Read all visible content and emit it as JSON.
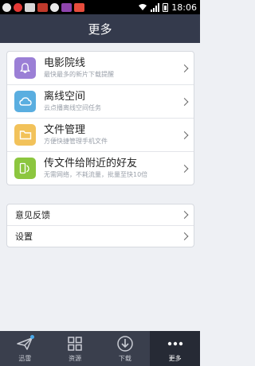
{
  "status_bar": {
    "time": "18:06",
    "notification_icons": [
      "qq-icon",
      "weibo-icon",
      "mail-icon",
      "image-icon",
      "qq-icon",
      "app-icon",
      "taobao-icon"
    ]
  },
  "header": {
    "title": "更多"
  },
  "menu_group": {
    "items": [
      {
        "icon": "bell-icon",
        "color": "#9b7fd6",
        "title": "电影院线",
        "subtitle": "最快最多的新片下载提醒"
      },
      {
        "icon": "cloud-icon",
        "color": "#5aaee0",
        "title": "离线空间",
        "subtitle": "云点播离线空间任务"
      },
      {
        "icon": "folder-icon",
        "color": "#f2c25a",
        "title": "文件管理",
        "subtitle": "方便快捷管理手机文件"
      },
      {
        "icon": "phone-share-icon",
        "color": "#8cc63f",
        "title": "传文件给附近的好友",
        "subtitle": "无需网络，不耗流量，批量至快10倍"
      }
    ]
  },
  "settings_group": {
    "items": [
      {
        "label": "意见反馈"
      },
      {
        "label": "设置"
      }
    ]
  },
  "tab_bar": {
    "tabs": [
      {
        "icon": "plane-icon",
        "label": "迅雷",
        "active": false,
        "badge": true
      },
      {
        "icon": "grid-icon",
        "label": "资源",
        "active": false,
        "badge": false
      },
      {
        "icon": "download-icon",
        "label": "下载",
        "active": false,
        "badge": false
      },
      {
        "icon": "more-dots-icon",
        "label": "更多",
        "active": true,
        "badge": false
      }
    ]
  }
}
